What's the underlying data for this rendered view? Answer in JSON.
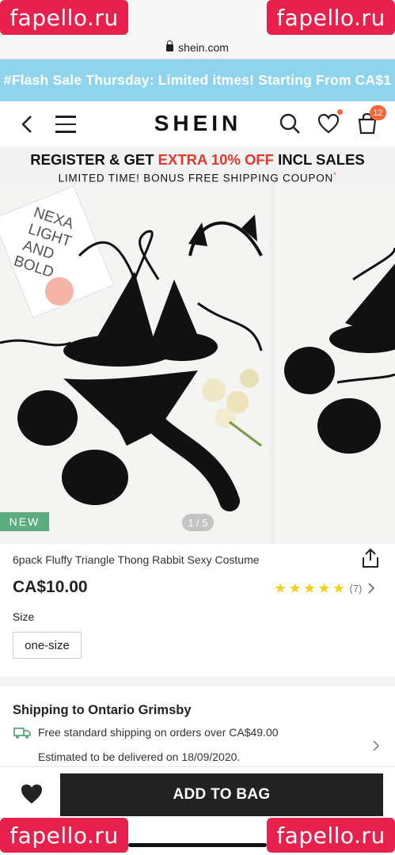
{
  "browser": {
    "url": "shein.com"
  },
  "banner": {
    "flash_text": "#Flash Sale Thursday: Limited itmes! Starting From CA$1"
  },
  "nav": {
    "logo": "SHEIN",
    "cart_count": "12"
  },
  "promo": {
    "line1_a": "REGISTER & GET ",
    "line1_red": "EXTRA 10% OFF",
    "line1_b": " INCL SALES",
    "line2": "LIMITED TIME! BONUS FREE SHIPPING COUPON",
    "line2_mark": "*"
  },
  "gallery": {
    "new_tag": "NEW",
    "pager": "1 / 5",
    "book_text": "NEXA LIGHT AND BOLD"
  },
  "product": {
    "title": "6pack Fluffy Triangle Thong Rabbit Sexy Costume",
    "price": "CA$10.00",
    "rating_stars": 5,
    "review_count": "(7)"
  },
  "size": {
    "label": "Size",
    "selected": "one-size"
  },
  "shipping": {
    "title": "Shipping to Ontario Grimsby",
    "free_line": "Free standard shipping on orders over CA$49.00",
    "delivery_line": "Estimated to be delivered on 18/09/2020."
  },
  "actions": {
    "add_to_bag": "ADD TO BAG"
  },
  "watermarks": {
    "text": "fapello.ru"
  },
  "colors": {
    "flash_bg": "#8fd4ed",
    "accent_red": "#e1392c",
    "badge": "#fa6338",
    "new_tag": "#5bad80",
    "star": "#facf19",
    "watermark": "#e8214c"
  }
}
